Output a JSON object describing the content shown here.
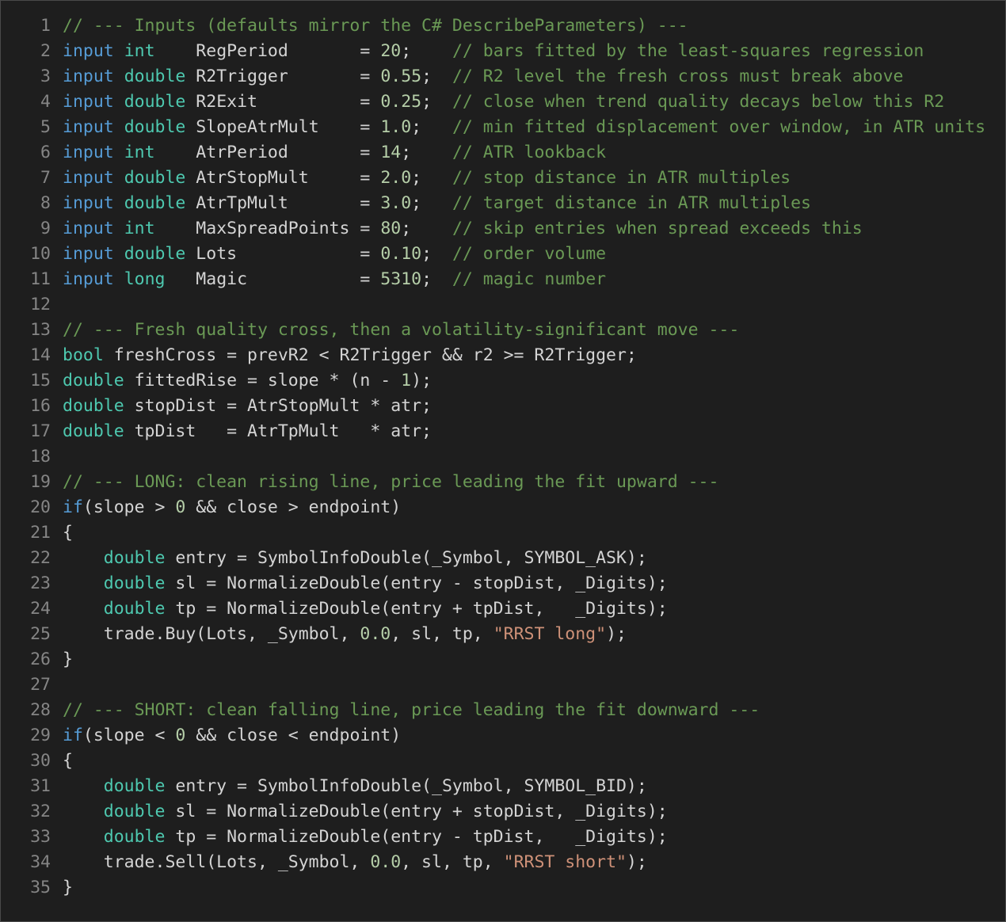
{
  "editor": {
    "language": "mql5",
    "colors": {
      "background": "#1e1e1e",
      "line_number": "#858585",
      "default": "#d4d4d4",
      "comment": "#6a9955",
      "keyword": "#569cd6",
      "type": "#4ec9b0",
      "number": "#b5cea8",
      "string": "#ce9178"
    },
    "lines": [
      {
        "n": "1",
        "tokens": [
          [
            "cm",
            "// --- Inputs (defaults mirror the C# DescribeParameters) ---"
          ]
        ]
      },
      {
        "n": "2",
        "tokens": [
          [
            "kw",
            "input"
          ],
          [
            "id",
            " "
          ],
          [
            "ty",
            "int"
          ],
          [
            "id",
            "    RegPeriod       = "
          ],
          [
            "num",
            "20"
          ],
          [
            "id",
            ";    "
          ],
          [
            "cm",
            "// bars fitted by the least-squares regression"
          ]
        ]
      },
      {
        "n": "3",
        "tokens": [
          [
            "kw",
            "input"
          ],
          [
            "id",
            " "
          ],
          [
            "ty",
            "double"
          ],
          [
            "id",
            " R2Trigger       = "
          ],
          [
            "num",
            "0.55"
          ],
          [
            "id",
            ";  "
          ],
          [
            "cm",
            "// R2 level the fresh cross must break above"
          ]
        ]
      },
      {
        "n": "4",
        "tokens": [
          [
            "kw",
            "input"
          ],
          [
            "id",
            " "
          ],
          [
            "ty",
            "double"
          ],
          [
            "id",
            " R2Exit          = "
          ],
          [
            "num",
            "0.25"
          ],
          [
            "id",
            ";  "
          ],
          [
            "cm",
            "// close when trend quality decays below this R2"
          ]
        ]
      },
      {
        "n": "5",
        "tokens": [
          [
            "kw",
            "input"
          ],
          [
            "id",
            " "
          ],
          [
            "ty",
            "double"
          ],
          [
            "id",
            " SlopeAtrMult    = "
          ],
          [
            "num",
            "1.0"
          ],
          [
            "id",
            ";   "
          ],
          [
            "cm",
            "// min fitted displacement over window, in ATR units"
          ]
        ]
      },
      {
        "n": "6",
        "tokens": [
          [
            "kw",
            "input"
          ],
          [
            "id",
            " "
          ],
          [
            "ty",
            "int"
          ],
          [
            "id",
            "    AtrPeriod       = "
          ],
          [
            "num",
            "14"
          ],
          [
            "id",
            ";    "
          ],
          [
            "cm",
            "// ATR lookback"
          ]
        ]
      },
      {
        "n": "7",
        "tokens": [
          [
            "kw",
            "input"
          ],
          [
            "id",
            " "
          ],
          [
            "ty",
            "double"
          ],
          [
            "id",
            " AtrStopMult     = "
          ],
          [
            "num",
            "2.0"
          ],
          [
            "id",
            ";   "
          ],
          [
            "cm",
            "// stop distance in ATR multiples"
          ]
        ]
      },
      {
        "n": "8",
        "tokens": [
          [
            "kw",
            "input"
          ],
          [
            "id",
            " "
          ],
          [
            "ty",
            "double"
          ],
          [
            "id",
            " AtrTpMult       = "
          ],
          [
            "num",
            "3.0"
          ],
          [
            "id",
            ";   "
          ],
          [
            "cm",
            "// target distance in ATR multiples"
          ]
        ]
      },
      {
        "n": "9",
        "tokens": [
          [
            "kw",
            "input"
          ],
          [
            "id",
            " "
          ],
          [
            "ty",
            "int"
          ],
          [
            "id",
            "    MaxSpreadPoints = "
          ],
          [
            "num",
            "80"
          ],
          [
            "id",
            ";    "
          ],
          [
            "cm",
            "// skip entries when spread exceeds this"
          ]
        ]
      },
      {
        "n": "10",
        "tokens": [
          [
            "kw",
            "input"
          ],
          [
            "id",
            " "
          ],
          [
            "ty",
            "double"
          ],
          [
            "id",
            " Lots            = "
          ],
          [
            "num",
            "0.10"
          ],
          [
            "id",
            ";  "
          ],
          [
            "cm",
            "// order volume"
          ]
        ]
      },
      {
        "n": "11",
        "tokens": [
          [
            "kw",
            "input"
          ],
          [
            "id",
            " "
          ],
          [
            "ty",
            "long"
          ],
          [
            "id",
            "   Magic           = "
          ],
          [
            "num",
            "5310"
          ],
          [
            "id",
            ";  "
          ],
          [
            "cm",
            "// magic number"
          ]
        ]
      },
      {
        "n": "12",
        "tokens": []
      },
      {
        "n": "13",
        "tokens": [
          [
            "cm",
            "// --- Fresh quality cross, then a volatility-significant move ---"
          ]
        ]
      },
      {
        "n": "14",
        "tokens": [
          [
            "ty",
            "bool"
          ],
          [
            "id",
            " freshCross = prevR2 < R2Trigger && r2 >= R2Trigger;"
          ]
        ]
      },
      {
        "n": "15",
        "tokens": [
          [
            "ty",
            "double"
          ],
          [
            "id",
            " fittedRise = slope * (n - "
          ],
          [
            "num",
            "1"
          ],
          [
            "id",
            ");"
          ]
        ]
      },
      {
        "n": "16",
        "tokens": [
          [
            "ty",
            "double"
          ],
          [
            "id",
            " stopDist = AtrStopMult * atr;"
          ]
        ]
      },
      {
        "n": "17",
        "tokens": [
          [
            "ty",
            "double"
          ],
          [
            "id",
            " tpDist   = AtrTpMult   * atr;"
          ]
        ]
      },
      {
        "n": "18",
        "tokens": []
      },
      {
        "n": "19",
        "tokens": [
          [
            "cm",
            "// --- LONG: clean rising line, price leading the fit upward ---"
          ]
        ]
      },
      {
        "n": "20",
        "tokens": [
          [
            "kw",
            "if"
          ],
          [
            "id",
            "(slope > "
          ],
          [
            "num",
            "0"
          ],
          [
            "id",
            " && close > endpoint)"
          ]
        ]
      },
      {
        "n": "21",
        "tokens": [
          [
            "id",
            "{"
          ]
        ]
      },
      {
        "n": "22",
        "tokens": [
          [
            "id",
            "    "
          ],
          [
            "ty",
            "double"
          ],
          [
            "id",
            " entry = SymbolInfoDouble(_Symbol, SYMBOL_ASK);"
          ]
        ]
      },
      {
        "n": "23",
        "tokens": [
          [
            "id",
            "    "
          ],
          [
            "ty",
            "double"
          ],
          [
            "id",
            " sl = NormalizeDouble(entry - stopDist, _Digits);"
          ]
        ]
      },
      {
        "n": "24",
        "tokens": [
          [
            "id",
            "    "
          ],
          [
            "ty",
            "double"
          ],
          [
            "id",
            " tp = NormalizeDouble(entry + tpDist,   _Digits);"
          ]
        ]
      },
      {
        "n": "25",
        "tokens": [
          [
            "id",
            "    trade.Buy(Lots, _Symbol, "
          ],
          [
            "num",
            "0.0"
          ],
          [
            "id",
            ", sl, tp, "
          ],
          [
            "str",
            "\"RRST long\""
          ],
          [
            "id",
            ");"
          ]
        ]
      },
      {
        "n": "26",
        "tokens": [
          [
            "id",
            "}"
          ]
        ]
      },
      {
        "n": "27",
        "tokens": []
      },
      {
        "n": "28",
        "tokens": [
          [
            "cm",
            "// --- SHORT: clean falling line, price leading the fit downward ---"
          ]
        ]
      },
      {
        "n": "29",
        "tokens": [
          [
            "kw",
            "if"
          ],
          [
            "id",
            "(slope < "
          ],
          [
            "num",
            "0"
          ],
          [
            "id",
            " && close < endpoint)"
          ]
        ]
      },
      {
        "n": "30",
        "tokens": [
          [
            "id",
            "{"
          ]
        ]
      },
      {
        "n": "31",
        "tokens": [
          [
            "id",
            "    "
          ],
          [
            "ty",
            "double"
          ],
          [
            "id",
            " entry = SymbolInfoDouble(_Symbol, SYMBOL_BID);"
          ]
        ]
      },
      {
        "n": "32",
        "tokens": [
          [
            "id",
            "    "
          ],
          [
            "ty",
            "double"
          ],
          [
            "id",
            " sl = NormalizeDouble(entry + stopDist, _Digits);"
          ]
        ]
      },
      {
        "n": "33",
        "tokens": [
          [
            "id",
            "    "
          ],
          [
            "ty",
            "double"
          ],
          [
            "id",
            " tp = NormalizeDouble(entry - tpDist,   _Digits);"
          ]
        ]
      },
      {
        "n": "34",
        "tokens": [
          [
            "id",
            "    trade.Sell(Lots, _Symbol, "
          ],
          [
            "num",
            "0.0"
          ],
          [
            "id",
            ", sl, tp, "
          ],
          [
            "str",
            "\"RRST short\""
          ],
          [
            "id",
            ");"
          ]
        ]
      },
      {
        "n": "35",
        "tokens": [
          [
            "id",
            "}"
          ]
        ]
      }
    ]
  }
}
